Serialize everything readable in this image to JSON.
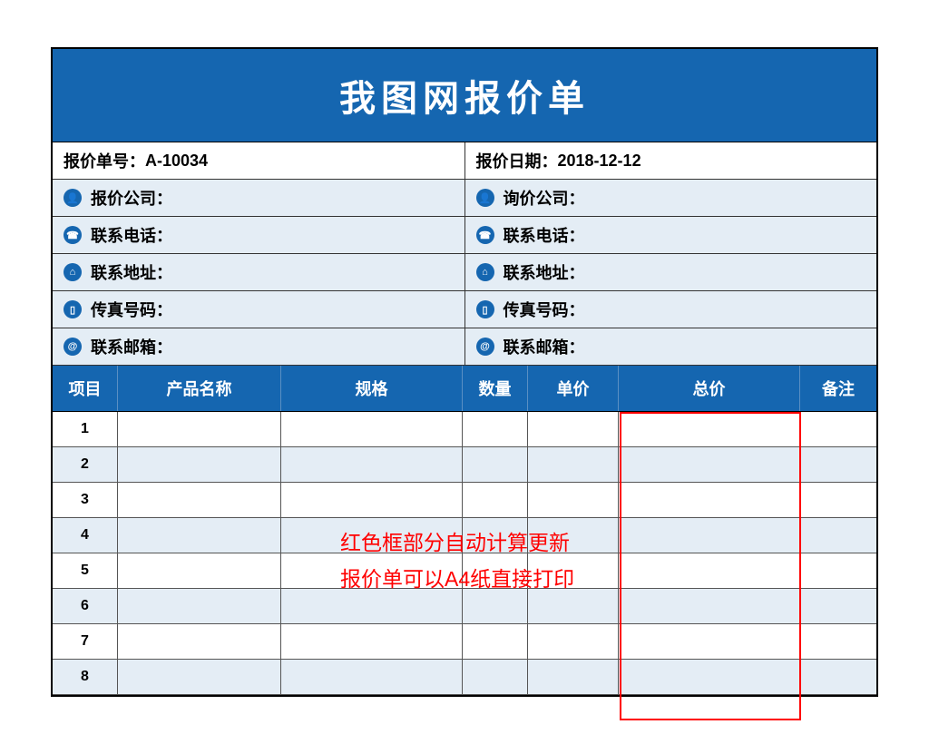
{
  "title": "我图网报价单",
  "quote_no_label": "报价单号：",
  "quote_no_value": "A-10034",
  "quote_date_label": "报价日期：",
  "quote_date_value": "2018-12-12",
  "left_info": [
    {
      "icon": "person",
      "label": "报价公司："
    },
    {
      "icon": "phone",
      "label": "联系电话："
    },
    {
      "icon": "location",
      "label": "联系地址："
    },
    {
      "icon": "mobile",
      "label": "传真号码："
    },
    {
      "icon": "at",
      "label": "联系邮箱："
    }
  ],
  "right_info": [
    {
      "icon": "person",
      "label": "询价公司："
    },
    {
      "icon": "phone",
      "label": "联系电话："
    },
    {
      "icon": "location",
      "label": "联系地址："
    },
    {
      "icon": "mobile",
      "label": "传真号码："
    },
    {
      "icon": "at",
      "label": "联系邮箱："
    }
  ],
  "col_headers": {
    "item": "项目",
    "name": "产品名称",
    "spec": "规格",
    "qty": "数量",
    "price": "单价",
    "total": "总价",
    "note": "备注"
  },
  "rows": [
    "1",
    "2",
    "3",
    "4",
    "5",
    "6",
    "7",
    "8"
  ],
  "annotation_line1": "红色框部分自动计算更新",
  "annotation_line2": "报价单可以A4纸直接打印",
  "icon_glyphs": {
    "person": "👤",
    "phone": "☎",
    "location": "⌂",
    "mobile": "▯",
    "at": "@"
  }
}
